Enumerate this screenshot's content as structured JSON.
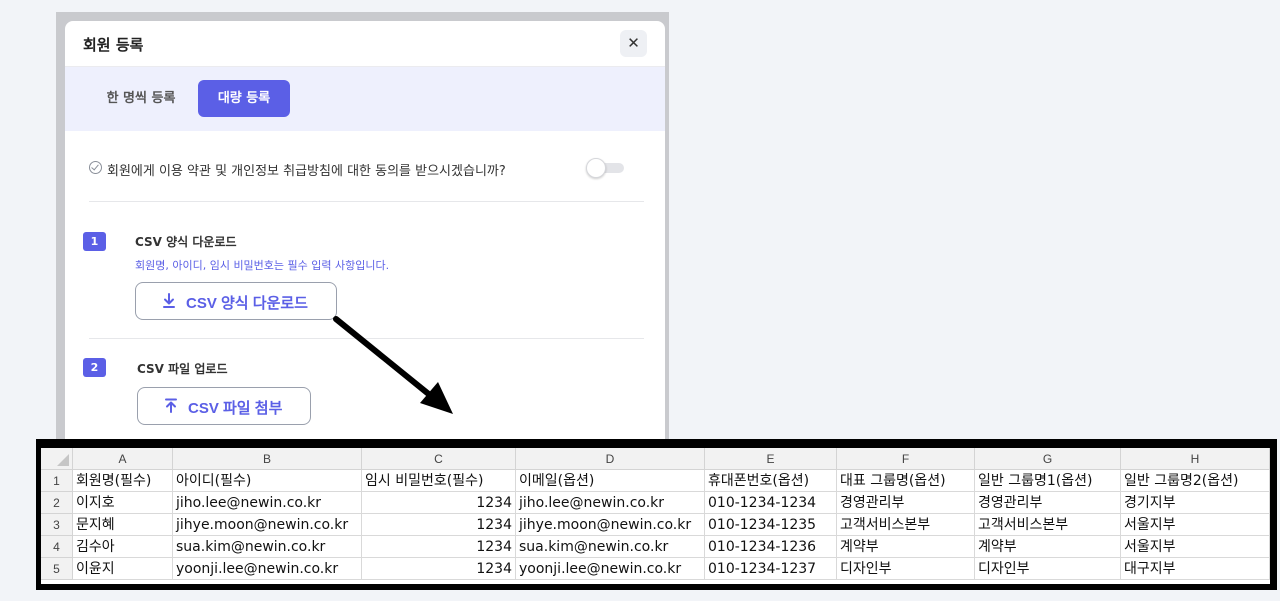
{
  "modal": {
    "title": "회원 등록",
    "close_label": "✕",
    "tabs": [
      {
        "label": "한 명씩 등록",
        "active": false
      },
      {
        "label": "대량 등록",
        "active": true
      }
    ],
    "consent": {
      "text": "회원에게 이용 약관 및 개인정보 취급방침에 대한 동의를 받으시겠습니까?",
      "toggle_on": false
    },
    "step1": {
      "number": "1",
      "title": "CSV 양식 다운로드",
      "note": "회원명, 아이디, 임시 비밀번호는 필수 입력 사항입니다.",
      "button_label": "CSV 양식 다운로드",
      "icon": "download-icon"
    },
    "step2": {
      "number": "2",
      "title": "CSV 파일 업로드",
      "button_label": "CSV 파일 첨부",
      "icon": "upload-icon"
    },
    "accent_color": "#5b5fe6"
  },
  "spreadsheet": {
    "columns": [
      "A",
      "B",
      "C",
      "D",
      "E",
      "F",
      "G",
      "H"
    ],
    "row_numbers": [
      "1",
      "2",
      "3",
      "4",
      "5"
    ],
    "rows": [
      [
        "회원명(필수)",
        "아이디(필수)",
        "임시 비밀번호(필수)",
        "이메일(옵션)",
        "휴대폰번호(옵션)",
        "대표 그룹명(옵션)",
        "일반 그룹명1(옵션)",
        "일반 그룹명2(옵션)"
      ],
      [
        "이지호",
        "jiho.lee@newin.co.kr",
        "1234",
        "jiho.lee@newin.co.kr",
        "010-1234-1234",
        "경영관리부",
        "경영관리부",
        "경기지부"
      ],
      [
        "문지혜",
        "jihye.moon@newin.co.kr",
        "1234",
        "jihye.moon@newin.co.kr",
        "010-1234-1235",
        "고객서비스본부",
        "고객서비스본부",
        "서울지부"
      ],
      [
        "김수아",
        "sua.kim@newin.co.kr",
        "1234",
        "sua.kim@newin.co.kr",
        "010-1234-1236",
        "계약부",
        "계약부",
        "서울지부"
      ],
      [
        "이윤지",
        "yoonji.lee@newin.co.kr",
        "1234",
        "yoonji.lee@newin.co.kr",
        "010-1234-1237",
        "디자인부",
        "디자인부",
        "대구지부"
      ]
    ]
  }
}
